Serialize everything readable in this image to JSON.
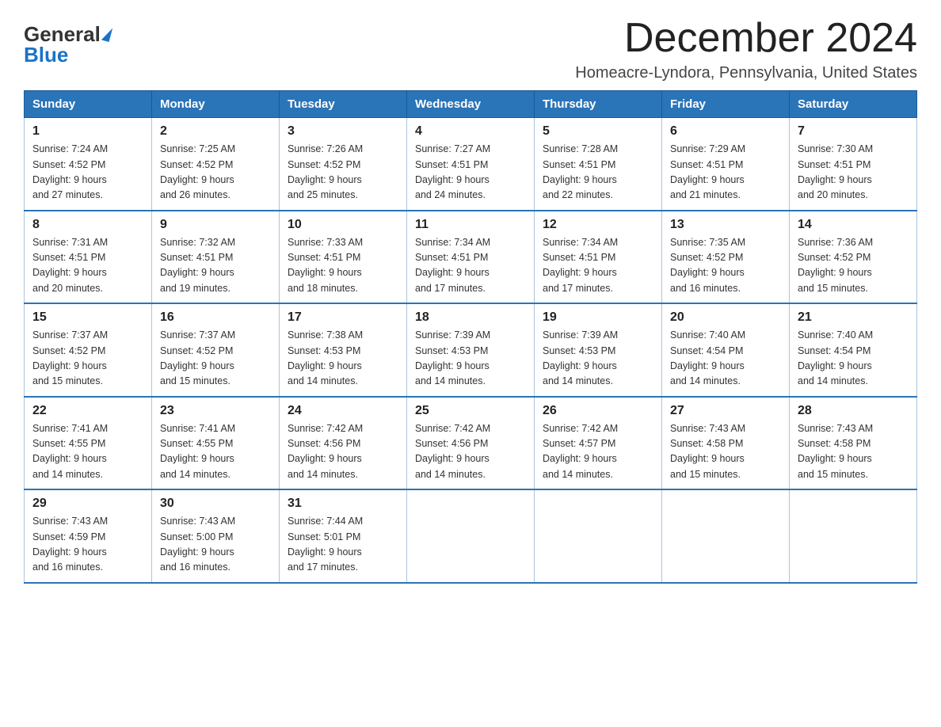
{
  "header": {
    "logo_general": "General",
    "logo_blue": "Blue",
    "month_title": "December 2024",
    "location": "Homeacre-Lyndora, Pennsylvania, United States"
  },
  "weekdays": [
    "Sunday",
    "Monday",
    "Tuesday",
    "Wednesday",
    "Thursday",
    "Friday",
    "Saturday"
  ],
  "weeks": [
    [
      {
        "day": "1",
        "sunrise": "7:24 AM",
        "sunset": "4:52 PM",
        "daylight": "9 hours and 27 minutes."
      },
      {
        "day": "2",
        "sunrise": "7:25 AM",
        "sunset": "4:52 PM",
        "daylight": "9 hours and 26 minutes."
      },
      {
        "day": "3",
        "sunrise": "7:26 AM",
        "sunset": "4:52 PM",
        "daylight": "9 hours and 25 minutes."
      },
      {
        "day": "4",
        "sunrise": "7:27 AM",
        "sunset": "4:51 PM",
        "daylight": "9 hours and 24 minutes."
      },
      {
        "day": "5",
        "sunrise": "7:28 AM",
        "sunset": "4:51 PM",
        "daylight": "9 hours and 22 minutes."
      },
      {
        "day": "6",
        "sunrise": "7:29 AM",
        "sunset": "4:51 PM",
        "daylight": "9 hours and 21 minutes."
      },
      {
        "day": "7",
        "sunrise": "7:30 AM",
        "sunset": "4:51 PM",
        "daylight": "9 hours and 20 minutes."
      }
    ],
    [
      {
        "day": "8",
        "sunrise": "7:31 AM",
        "sunset": "4:51 PM",
        "daylight": "9 hours and 20 minutes."
      },
      {
        "day": "9",
        "sunrise": "7:32 AM",
        "sunset": "4:51 PM",
        "daylight": "9 hours and 19 minutes."
      },
      {
        "day": "10",
        "sunrise": "7:33 AM",
        "sunset": "4:51 PM",
        "daylight": "9 hours and 18 minutes."
      },
      {
        "day": "11",
        "sunrise": "7:34 AM",
        "sunset": "4:51 PM",
        "daylight": "9 hours and 17 minutes."
      },
      {
        "day": "12",
        "sunrise": "7:34 AM",
        "sunset": "4:51 PM",
        "daylight": "9 hours and 17 minutes."
      },
      {
        "day": "13",
        "sunrise": "7:35 AM",
        "sunset": "4:52 PM",
        "daylight": "9 hours and 16 minutes."
      },
      {
        "day": "14",
        "sunrise": "7:36 AM",
        "sunset": "4:52 PM",
        "daylight": "9 hours and 15 minutes."
      }
    ],
    [
      {
        "day": "15",
        "sunrise": "7:37 AM",
        "sunset": "4:52 PM",
        "daylight": "9 hours and 15 minutes."
      },
      {
        "day": "16",
        "sunrise": "7:37 AM",
        "sunset": "4:52 PM",
        "daylight": "9 hours and 15 minutes."
      },
      {
        "day": "17",
        "sunrise": "7:38 AM",
        "sunset": "4:53 PM",
        "daylight": "9 hours and 14 minutes."
      },
      {
        "day": "18",
        "sunrise": "7:39 AM",
        "sunset": "4:53 PM",
        "daylight": "9 hours and 14 minutes."
      },
      {
        "day": "19",
        "sunrise": "7:39 AM",
        "sunset": "4:53 PM",
        "daylight": "9 hours and 14 minutes."
      },
      {
        "day": "20",
        "sunrise": "7:40 AM",
        "sunset": "4:54 PM",
        "daylight": "9 hours and 14 minutes."
      },
      {
        "day": "21",
        "sunrise": "7:40 AM",
        "sunset": "4:54 PM",
        "daylight": "9 hours and 14 minutes."
      }
    ],
    [
      {
        "day": "22",
        "sunrise": "7:41 AM",
        "sunset": "4:55 PM",
        "daylight": "9 hours and 14 minutes."
      },
      {
        "day": "23",
        "sunrise": "7:41 AM",
        "sunset": "4:55 PM",
        "daylight": "9 hours and 14 minutes."
      },
      {
        "day": "24",
        "sunrise": "7:42 AM",
        "sunset": "4:56 PM",
        "daylight": "9 hours and 14 minutes."
      },
      {
        "day": "25",
        "sunrise": "7:42 AM",
        "sunset": "4:56 PM",
        "daylight": "9 hours and 14 minutes."
      },
      {
        "day": "26",
        "sunrise": "7:42 AM",
        "sunset": "4:57 PM",
        "daylight": "9 hours and 14 minutes."
      },
      {
        "day": "27",
        "sunrise": "7:43 AM",
        "sunset": "4:58 PM",
        "daylight": "9 hours and 15 minutes."
      },
      {
        "day": "28",
        "sunrise": "7:43 AM",
        "sunset": "4:58 PM",
        "daylight": "9 hours and 15 minutes."
      }
    ],
    [
      {
        "day": "29",
        "sunrise": "7:43 AM",
        "sunset": "4:59 PM",
        "daylight": "9 hours and 16 minutes."
      },
      {
        "day": "30",
        "sunrise": "7:43 AM",
        "sunset": "5:00 PM",
        "daylight": "9 hours and 16 minutes."
      },
      {
        "day": "31",
        "sunrise": "7:44 AM",
        "sunset": "5:01 PM",
        "daylight": "9 hours and 17 minutes."
      },
      null,
      null,
      null,
      null
    ]
  ],
  "labels": {
    "sunrise": "Sunrise:",
    "sunset": "Sunset:",
    "daylight": "Daylight:"
  }
}
